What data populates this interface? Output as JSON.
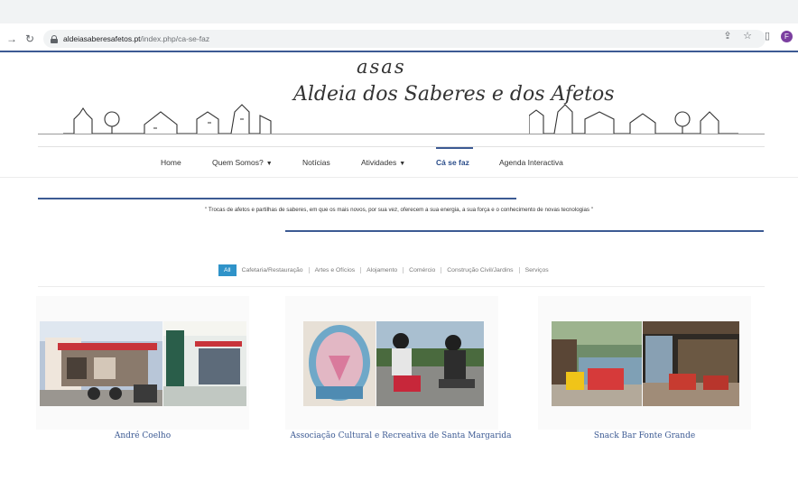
{
  "browser": {
    "url_domain": "aldeiasaberesafetos.pt",
    "url_path": "/index.php/ca-se-faz",
    "avatar_letter": "F"
  },
  "logo": {
    "small": "asas",
    "big": "Aldeia dos Saberes e dos Afetos"
  },
  "nav": {
    "items": [
      {
        "label": "Home"
      },
      {
        "label": "Quem Somos?"
      },
      {
        "label": "Notícias"
      },
      {
        "label": "Atividades"
      },
      {
        "label": "Cá se faz"
      },
      {
        "label": "Agenda Interactiva"
      }
    ],
    "active": "Cá se faz"
  },
  "quote": "\" Trocas de afetos e partilhas de saberes, em que os mais novos, por sua vez, oferecem a sua energia, a sua força e o conhecimento de novas tecnologias \"",
  "filters": [
    {
      "label": "All"
    },
    {
      "label": "Cafetaria/Restauração"
    },
    {
      "label": "Artes e Ofícios"
    },
    {
      "label": "Alojamento"
    },
    {
      "label": "Comércio"
    },
    {
      "label": "Construção Civil/Jardins"
    },
    {
      "label": "Serviços"
    }
  ],
  "cards": [
    {
      "title": "André Coelho"
    },
    {
      "title": "Associação Cultural e Recreativa de Santa Margarida"
    },
    {
      "title": "Snack Bar Fonte Grande"
    }
  ],
  "colors": {
    "accent": "#3c5a93",
    "filter_active": "#2f93c9"
  }
}
